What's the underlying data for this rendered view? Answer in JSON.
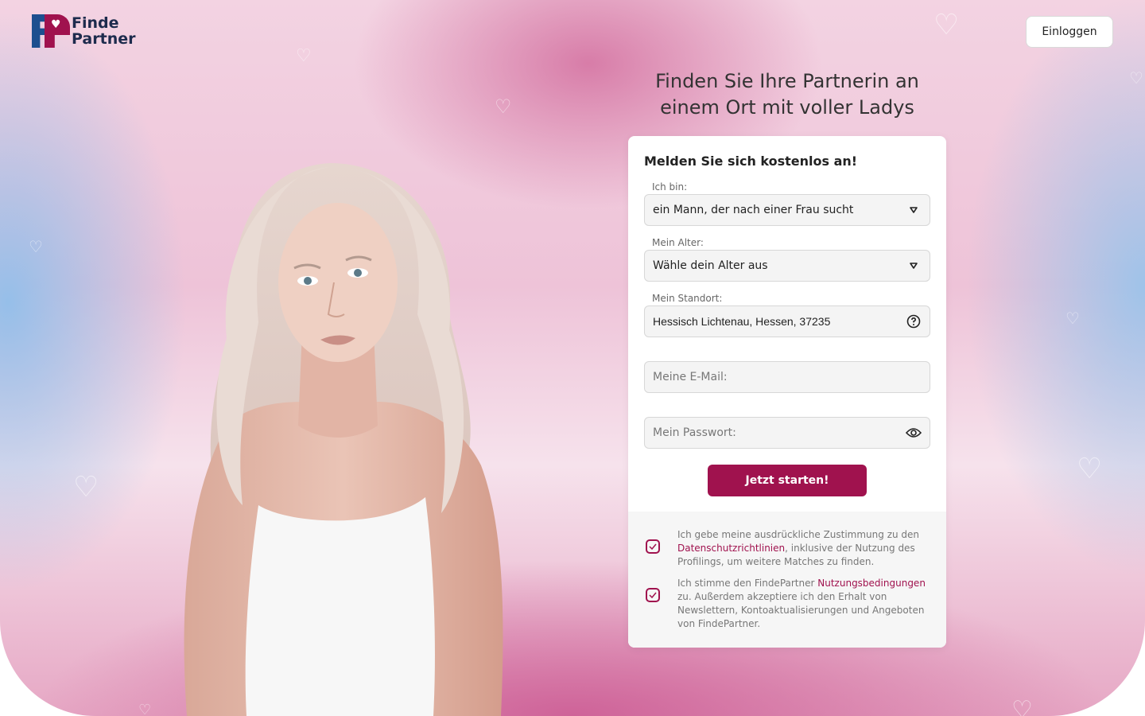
{
  "header": {
    "logo_line1": "Finde",
    "logo_line2": "Partner",
    "login_label": "Einloggen"
  },
  "headline": "Finden Sie Ihre Partnerin an einem Ort mit voller Ladys",
  "form": {
    "title": "Melden Sie sich kostenlos an!",
    "i_am_label": "Ich bin:",
    "i_am_value": "ein Mann, der nach einer Frau sucht",
    "age_label": "Mein Alter:",
    "age_value": "Wähle dein Alter aus",
    "location_label": "Mein Standort:",
    "location_value": "Hessisch Lichtenau, Hessen, 37235",
    "email_placeholder": "Meine E-Mail:",
    "password_placeholder": "Mein Passwort:",
    "submit_label": "Jetzt starten!"
  },
  "consent": {
    "privacy_before": "Ich gebe meine ausdrückliche Zustimmung zu den",
    "privacy_link": "Datenschutzrichtlinien",
    "privacy_after": ", inklusive der Nutzung des Profilings, um weitere Matches zu finden.",
    "terms_before": "Ich stimme den FindePartner",
    "terms_link": "Nutzungsbedingungen",
    "terms_after": "zu. Außerdem akzeptiere ich den Erhalt von Newslettern, Kontoaktualisierungen und Angeboten von FindePartner."
  },
  "colors": {
    "brand_accent": "#a0124e",
    "brand_navy": "#1d4f8f"
  },
  "icons": {
    "dropdown": "caret-down-icon",
    "help": "question-circle-icon",
    "password_toggle": "eye-icon",
    "check": "checkmark-icon"
  }
}
